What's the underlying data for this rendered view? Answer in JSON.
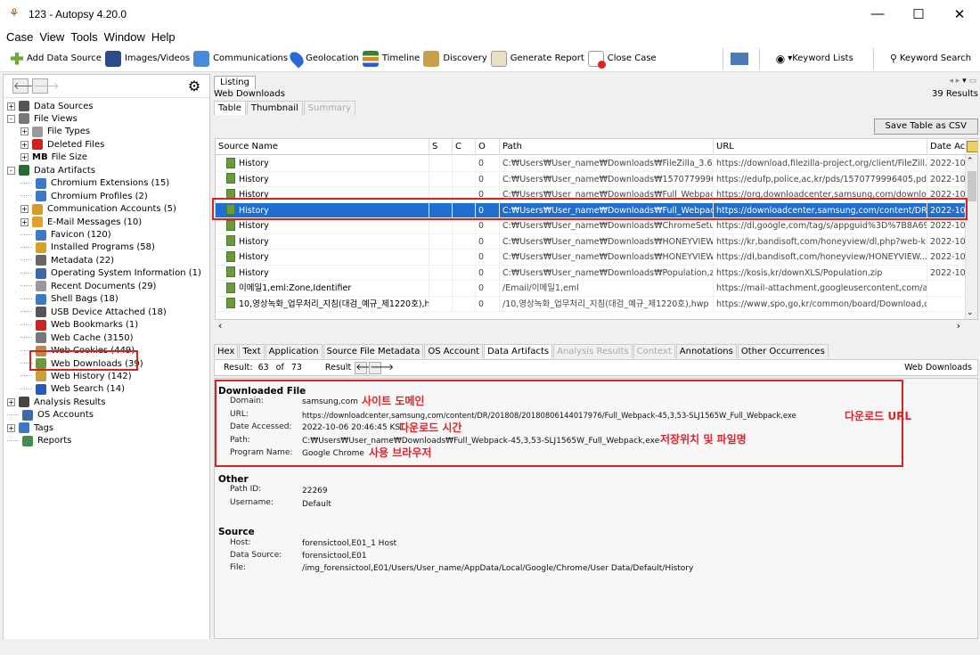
{
  "window": {
    "title": "123 - Autopsy 4.20.0"
  },
  "menu": [
    "Case",
    "View",
    "Tools",
    "Window",
    "Help"
  ],
  "toolbar": [
    {
      "label": "Add Data Source",
      "icon": "plus-icon"
    },
    {
      "label": "Images/Videos",
      "icon": "images-icon"
    },
    {
      "label": "Communications",
      "icon": "communications-icon"
    },
    {
      "label": "Geolocation",
      "icon": "map-pin-icon"
    },
    {
      "label": "Timeline",
      "icon": "timeline-icon"
    },
    {
      "label": "Discovery",
      "icon": "binoculars-icon"
    },
    {
      "label": "Generate Report",
      "icon": "report-icon"
    },
    {
      "label": "Close Case",
      "icon": "close-case-icon"
    }
  ],
  "toolbar_right": {
    "keyword_lists": "Keyword Lists",
    "keyword_search": "Keyword Search"
  },
  "tree": [
    {
      "label": "Data Sources",
      "level": 0,
      "exp": "+",
      "icon": "database-icon",
      "color": "#555"
    },
    {
      "label": "File Views",
      "level": 0,
      "exp": "-",
      "icon": "eye-icon",
      "color": "#777"
    },
    {
      "label": "File Types",
      "level": 1,
      "exp": "+",
      "icon": "file-types-icon",
      "color": "#999"
    },
    {
      "label": "Deleted Files",
      "level": 1,
      "exp": "+",
      "icon": "deleted-icon",
      "color": "#c22"
    },
    {
      "label": "File Size",
      "level": 1,
      "exp": "+",
      "icon": "mb-icon",
      "color": "#000",
      "prefix": "MB"
    },
    {
      "label": "Data Artifacts",
      "level": 0,
      "exp": "-",
      "icon": "artifacts-icon",
      "color": "#2a6a2a"
    },
    {
      "label": "Chromium Extensions (15)",
      "level": 1,
      "icon": "extension-icon",
      "color": "#3a7ac8"
    },
    {
      "label": "Chromium Profiles (2)",
      "level": 1,
      "icon": "profile-icon",
      "color": "#3a7ac8"
    },
    {
      "label": "Communication Accounts (5)",
      "level": 1,
      "exp": "+",
      "icon": "accounts-icon",
      "color": "#d89a2a"
    },
    {
      "label": "E-Mail Messages (10)",
      "level": 1,
      "exp": "+",
      "icon": "email-icon",
      "color": "#e0a02a"
    },
    {
      "label": "Favicon (120)",
      "level": 1,
      "icon": "favicon-icon",
      "color": "#3a7ac8"
    },
    {
      "label": "Installed Programs (58)",
      "level": 1,
      "icon": "programs-icon",
      "color": "#d8a02a"
    },
    {
      "label": "Metadata (22)",
      "level": 1,
      "icon": "metadata-icon",
      "color": "#666"
    },
    {
      "label": "Operating System Information (1)",
      "level": 1,
      "icon": "os-icon",
      "color": "#3a6aa8"
    },
    {
      "label": "Recent Documents (29)",
      "level": 1,
      "icon": "recent-docs-icon",
      "color": "#999"
    },
    {
      "label": "Shell Bags (18)",
      "level": 1,
      "icon": "shellbags-icon",
      "color": "#3a7ac8"
    },
    {
      "label": "USB Device Attached (18)",
      "level": 1,
      "icon": "usb-icon",
      "color": "#555"
    },
    {
      "label": "Web Bookmarks (1)",
      "level": 1,
      "icon": "bookmark-icon",
      "color": "#c22"
    },
    {
      "label": "Web Cache (3150)",
      "level": 1,
      "icon": "cache-icon",
      "color": "#777"
    },
    {
      "label": "Web Cookies (449)",
      "level": 1,
      "icon": "cookie-icon",
      "color": "#b88a4a"
    },
    {
      "label": "Web Downloads (39)",
      "level": 1,
      "icon": "download-icon",
      "color": "#6a9b3a"
    },
    {
      "label": "Web History (142)",
      "level": 1,
      "icon": "history-icon",
      "color": "#c8a03a"
    },
    {
      "label": "Web Search (14)",
      "level": 1,
      "icon": "web-search-icon",
      "color": "#2a5ab8"
    },
    {
      "label": "Analysis Results",
      "level": 0,
      "exp": "+",
      "icon": "analysis-icon",
      "color": "#444"
    },
    {
      "label": "OS Accounts",
      "level": 0,
      "icon": "os-accounts-icon",
      "color": "#3a6aa8"
    },
    {
      "label": "Tags",
      "level": 0,
      "exp": "+",
      "icon": "tags-icon",
      "color": "#3a7ac8"
    },
    {
      "label": "Reports",
      "level": 0,
      "icon": "reports-icon",
      "color": "#4a8a4a"
    }
  ],
  "listing": {
    "tab": "Listing",
    "title": "Web Downloads",
    "count": "39  Results",
    "subtabs": [
      "Table",
      "Thumbnail",
      "Summary"
    ],
    "save_button": "Save Table as CSV",
    "columns": [
      "Source Name",
      "S",
      "C",
      "O",
      "Path",
      "URL",
      "Date Ac"
    ],
    "rows": [
      {
        "name": "History",
        "o": "0",
        "path": "C:₩Users₩User_name₩Downloads₩FileZilla_3.61,...",
        "url": "https://download,filezilla-project,org/client/FileZill...",
        "date": "2022-10-0"
      },
      {
        "name": "History",
        "o": "0",
        "path": "C:₩Users₩User_name₩Downloads₩1570779996404,...",
        "url": "https://edufp,police,ac,kr/pds/1570779996405,pdf",
        "date": "2022-10-0"
      },
      {
        "name": "History",
        "o": "0",
        "path": "C:₩Users₩User_name₩Downloads₩Full_Webpac...",
        "url": "https://org,downloadcenter,samsung,com/downloa...",
        "date": "2022-10-0"
      },
      {
        "name": "History",
        "o": "0",
        "path": "C:₩Users₩User_name₩Downloads₩Full_Webpac...",
        "url": "https://downloadcenter,samsung,com/content/DR/...",
        "date": "2022-10-0",
        "selected": true
      },
      {
        "name": "History",
        "o": "0",
        "path": "C:₩Users₩User_name₩Downloads₩ChromeSetup...",
        "url": "https://dl,google,com/tag/s/appguid%3D%7B8A69D...",
        "date": "2022-10-0"
      },
      {
        "name": "History",
        "o": "0",
        "path": "C:₩Users₩User_name₩Downloads₩HONEYVIEW-...",
        "url": "https://kr,bandisoft,com/honeyview/dl,php?web-kr",
        "date": "2022-10-0"
      },
      {
        "name": "History",
        "o": "0",
        "path": "C:₩Users₩User_name₩Downloads₩HONEYVIEW-...",
        "url": "https://dl,bandisoft,com/honeyview/HONEYVIEW...",
        "date": "2022-10-0"
      },
      {
        "name": "History",
        "o": "0",
        "path": "C:₩Users₩User_name₩Downloads₩Population,zip",
        "url": "https://kosis,kr/downXLS/Population,zip",
        "date": "2022-10-0"
      },
      {
        "name": "이메일1,eml:Zone,Identifier",
        "o": "0",
        "path": "/Email/이메일1,eml",
        "url": "https://mail-attachment,googleusercontent,com/att...",
        "date": ""
      },
      {
        "name": "10,영상녹화_업무처리_지침(대검_예규_제1220호),hw",
        "o": "0",
        "path": "/10,영상녹화_업무처리_지침(대검_예규_제1220호),hwp",
        "url": "https://www,spo,go,kr/common/board/Download,d...",
        "date": ""
      }
    ]
  },
  "lower_tabs": [
    "Hex",
    "Text",
    "Application",
    "Source File Metadata",
    "OS Account",
    "Data Artifacts",
    "Analysis Results",
    "Context",
    "Annotations",
    "Other Occurrences"
  ],
  "result_bar": {
    "result_label": "Result:",
    "current": "63",
    "of": "of",
    "total": "73",
    "nav_label": "Result",
    "type": "Web Downloads"
  },
  "details": {
    "downloaded_file": {
      "heading": "Downloaded File",
      "fields": [
        {
          "label": "Domain:",
          "value": "samsung,com"
        },
        {
          "label": "URL:",
          "value": "https://downloadcenter,samsung,com/content/DR/201808/20180806144017976/Full_Webpack-45,3,53-SLJ1565W_Full_Webpack,exe"
        },
        {
          "label": "Date Accessed:",
          "value": "2022-10-06 20:46:45 KST"
        },
        {
          "label": "Path:",
          "value": "C:₩Users₩User_name₩Downloads₩Full_Webpack-45,3,53-SLJ1565W_Full_Webpack,exe"
        },
        {
          "label": "Program Name:",
          "value": "Google Chrome"
        }
      ]
    },
    "other": {
      "heading": "Other",
      "fields": [
        {
          "label": "Path ID:",
          "value": "22269"
        },
        {
          "label": "Username:",
          "value": "Default"
        }
      ]
    },
    "source": {
      "heading": "Source",
      "fields": [
        {
          "label": "Host:",
          "value": "forensictool,E01_1 Host"
        },
        {
          "label": "Data Source:",
          "value": "forensictool,E01"
        },
        {
          "label": "File:",
          "value": "/img_forensictool,E01/Users/User_name/AppData/Local/Google/Chrome/User Data/Default/History"
        }
      ]
    }
  },
  "annotations": {
    "domain": "사이트 도메인",
    "url": "다운로드 URL",
    "date": "다운로드 시간",
    "path": "저장위치 및 파일명",
    "program": "사용 브라우저"
  },
  "colors": {
    "selection": "#1e6fd0",
    "highlight_box": "#d52323",
    "annotation_text": "#e0242a"
  }
}
